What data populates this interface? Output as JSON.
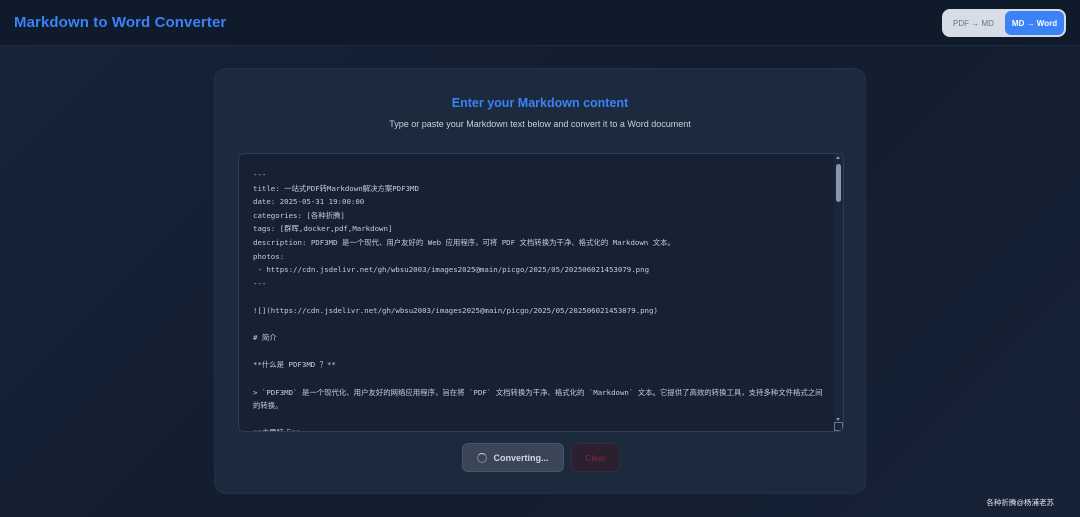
{
  "header": {
    "title": "Markdown to Word Converter",
    "modes": [
      {
        "label": "PDF → MD",
        "active": false
      },
      {
        "label": "MD → Word",
        "active": true
      }
    ]
  },
  "card": {
    "title": "Enter your Markdown content",
    "subtitle": "Type or paste your Markdown text below and convert it to a Word document"
  },
  "editor": {
    "content": "---\ntitle: 一站式PDF转Markdown解决方案PDF3MD\ndate: 2025-05-31 19:00:00\ncategories: [各种折腾]\ntags: [群晖,docker,pdf,Markdown]\ndescription: PDF3MD 是一个现代、用户友好的 Web 应用程序，可将 PDF 文档转换为干净、格式化的 Markdown 文本。\nphotos:\n - https://cdn.jsdelivr.net/gh/wbsu2003/images2025@main/picgo/2025/05/202506021453079.png\n---\n\n![](https://cdn.jsdelivr.net/gh/wbsu2003/images2025@main/picgo/2025/05/202506021453079.png)\n\n# 简介\n\n**什么是 PDF3MD ？**\n\n> `PDF3MD` 是一个现代化、用户友好的网络应用程序，旨在将 `PDF` 文档转换为干净、格式化的 `Markdown` 文本。它提供了高效的转换工具，支持多种文件格式之间的转换。\n\n**主要特点**"
  },
  "actions": {
    "convert_label": "Converting...",
    "clear_label": "Clear"
  },
  "footer": {
    "text": "各种折腾@杨浦老苏"
  },
  "colors": {
    "accent": "#3b82f6",
    "background": "#142033",
    "card": "#1c2a3e"
  }
}
